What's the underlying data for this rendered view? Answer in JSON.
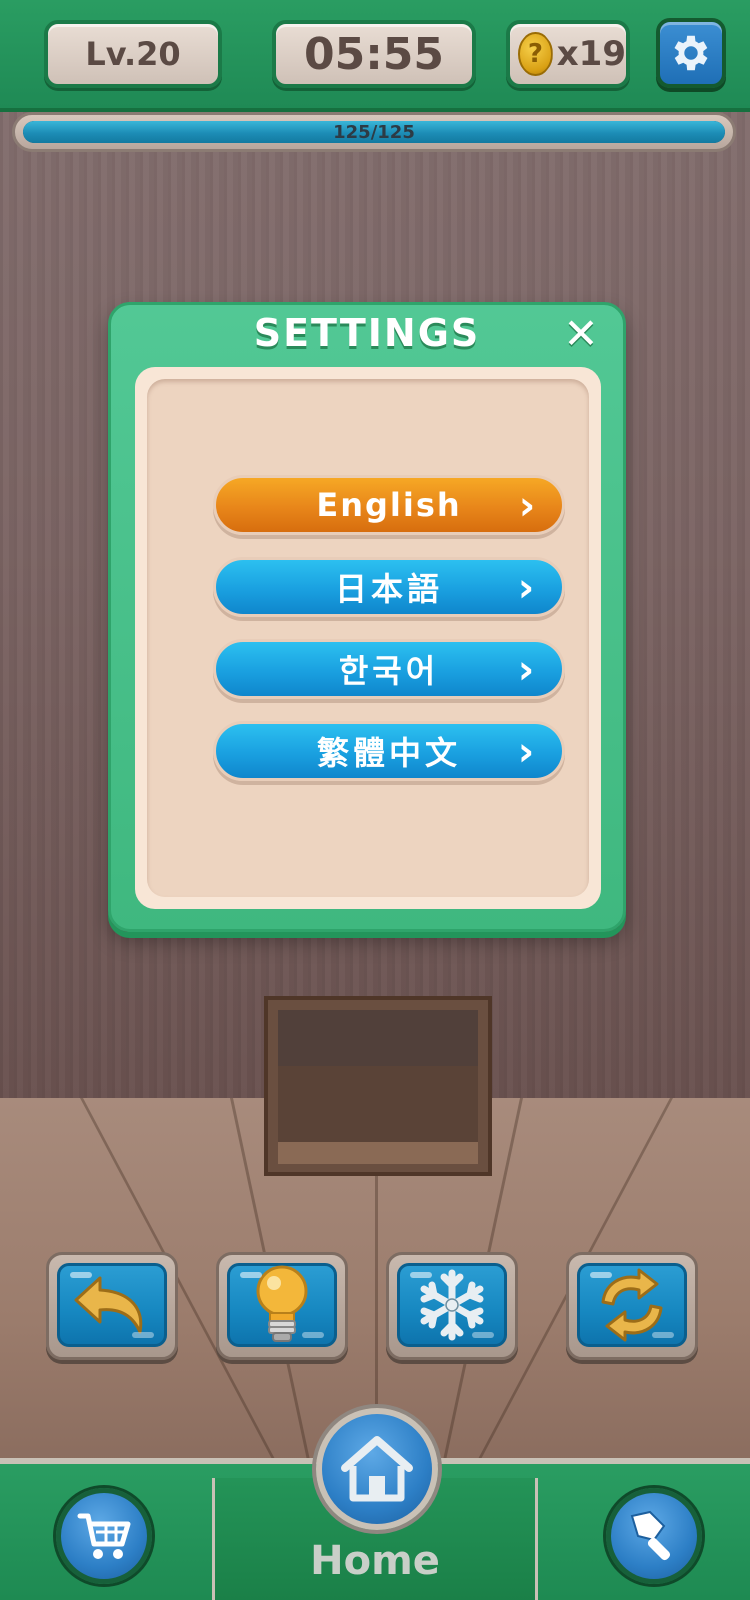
{
  "header": {
    "level": "Lv.20",
    "timer": "05:55",
    "hints_count": "x19",
    "hint_coin_symbol": "?"
  },
  "progress": {
    "label": "125/125",
    "value": 125,
    "max": 125
  },
  "settings_modal": {
    "title": "SETTINGS",
    "close_symbol": "✕",
    "languages": [
      {
        "label": "English",
        "selected": true
      },
      {
        "label": "日本語",
        "selected": false
      },
      {
        "label": "한국어",
        "selected": false
      },
      {
        "label": "繁體中文",
        "selected": false
      }
    ],
    "chevron": "›"
  },
  "powerups": [
    {
      "icon": "undo-arrow-icon"
    },
    {
      "icon": "lightbulb-icon"
    },
    {
      "icon": "snowflake-icon"
    },
    {
      "icon": "refresh-icon"
    }
  ],
  "bottom_nav": {
    "home_label": "Home",
    "left_icon": "cart-icon",
    "right_icon": "paintbrush-icon"
  },
  "colors": {
    "primary_green": "#2a9d62",
    "selected_orange": "#e8861a",
    "language_blue": "#1aa0e0",
    "modal_inner": "#edd4c0"
  }
}
